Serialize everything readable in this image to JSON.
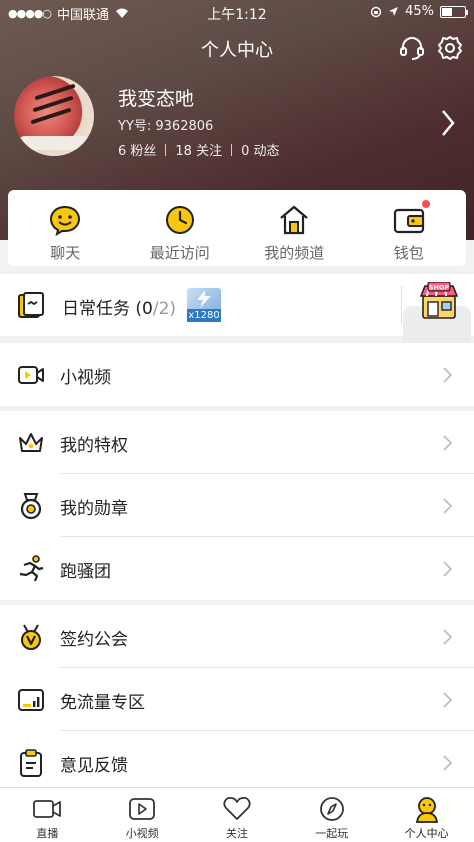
{
  "status_bar": {
    "carrier": "中国联通",
    "time": "上午1:12",
    "battery_percent": "45%",
    "battery_level": 0.45
  },
  "nav": {
    "title": "个人中心",
    "support_icon": "headset-icon",
    "settings_icon": "gear-icon"
  },
  "profile": {
    "username": "我变态吔",
    "yy_id": "YY号: 9362806",
    "fans": "6 粉丝",
    "following": "18 关注",
    "posts": "0 动态"
  },
  "quick_actions": [
    {
      "label": "聊天",
      "icon": "chat-face-icon"
    },
    {
      "label": "最近访问",
      "icon": "clock-icon"
    },
    {
      "label": "我的频道",
      "icon": "house-icon"
    },
    {
      "label": "钱包",
      "icon": "wallet-icon",
      "has_badge": true
    }
  ],
  "daily_task": {
    "label": "日常任务",
    "progress_open": " (",
    "progress_done": "0",
    "progress_total": "/2)",
    "reward": "x1280",
    "shop_icon": "shop-icon"
  },
  "menu_groups": [
    [
      {
        "label": "小视频",
        "icon": "video-icon"
      }
    ],
    [
      {
        "label": "我的特权",
        "icon": "crown-icon"
      },
      {
        "label": "我的勋章",
        "icon": "medal-icon"
      },
      {
        "label": "跑骚团",
        "icon": "runner-icon"
      }
    ],
    [
      {
        "label": "签约公会",
        "icon": "v-badge-icon"
      },
      {
        "label": "免流量专区",
        "icon": "data-chart-icon"
      },
      {
        "label": "意见反馈",
        "icon": "clipboard-icon"
      }
    ]
  ],
  "tabbar": [
    {
      "label": "直播",
      "icon": "camera-icon"
    },
    {
      "label": "小视频",
      "icon": "play-icon"
    },
    {
      "label": "关注",
      "icon": "heart-icon"
    },
    {
      "label": "一起玩",
      "icon": "compass-icon"
    },
    {
      "label": "个人中心",
      "icon": "profile-icon",
      "active": true
    }
  ],
  "colors": {
    "accent": "#f9c70b",
    "header_bg": "#5e4a45",
    "badge_red": "#ff4d4d"
  }
}
